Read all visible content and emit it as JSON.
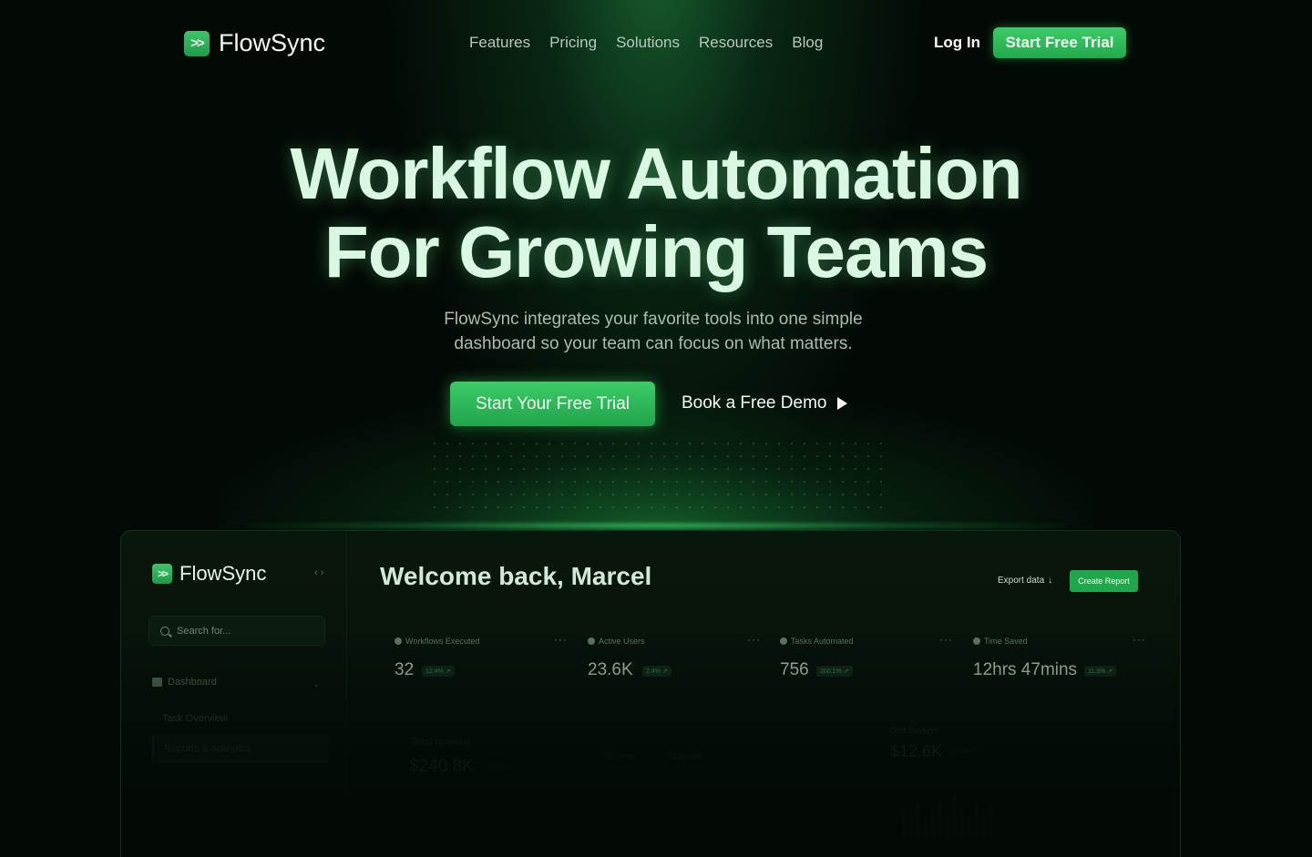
{
  "nav": {
    "brand": "FlowSync",
    "links": [
      "Features",
      "Pricing",
      "Solutions",
      "Resources",
      "Blog"
    ],
    "login": "Log In",
    "cta": "Start Free Trial"
  },
  "hero": {
    "title_line1": "Workflow Automation",
    "title_line2": "For Growing Teams",
    "subtitle_line1": "FlowSync integrates your favorite tools into one simple",
    "subtitle_line2": "dashboard so your team can focus on what matters.",
    "primary_cta": "Start Your Free Trial",
    "secondary_cta": "Book a Free Demo"
  },
  "dashboard": {
    "brand": "FlowSync",
    "search_placeholder": "Search for...",
    "nav": {
      "dashboard": "Dashboard",
      "task_overview": "Task Overview",
      "reports": "Reports & Analytics"
    },
    "welcome": "Welcome back, Marcel",
    "export_label": "Export data",
    "create_report": "Create Report",
    "stats": [
      {
        "label": "Workflows Executed",
        "value": "32",
        "badge": "12.4% ↗"
      },
      {
        "label": "Active Users",
        "value": "23.6K",
        "badge": "2.4% ↗"
      },
      {
        "label": "Tasks Automated",
        "value": "756",
        "badge": "200.1% ↗"
      },
      {
        "label": "Time Saved",
        "value": "12hrs 47mins",
        "badge": "11.3% ↗"
      }
    ],
    "revenue": {
      "label": "Total revenue",
      "value": "$240.8K",
      "badge": "24.6% ↗"
    },
    "legend": [
      "Revenue",
      "Expenses"
    ],
    "cost": {
      "label": "Cost Savings",
      "value": "$12.6K",
      "badge": "23.4% ↗"
    }
  },
  "colors": {
    "accent": "#22a94c",
    "background": "#030a05",
    "heading": "#d9f7e1"
  },
  "icons": {
    "logo": "double-chevron-right-icon",
    "play": "play-icon",
    "search": "search-icon",
    "home": "home-icon"
  }
}
